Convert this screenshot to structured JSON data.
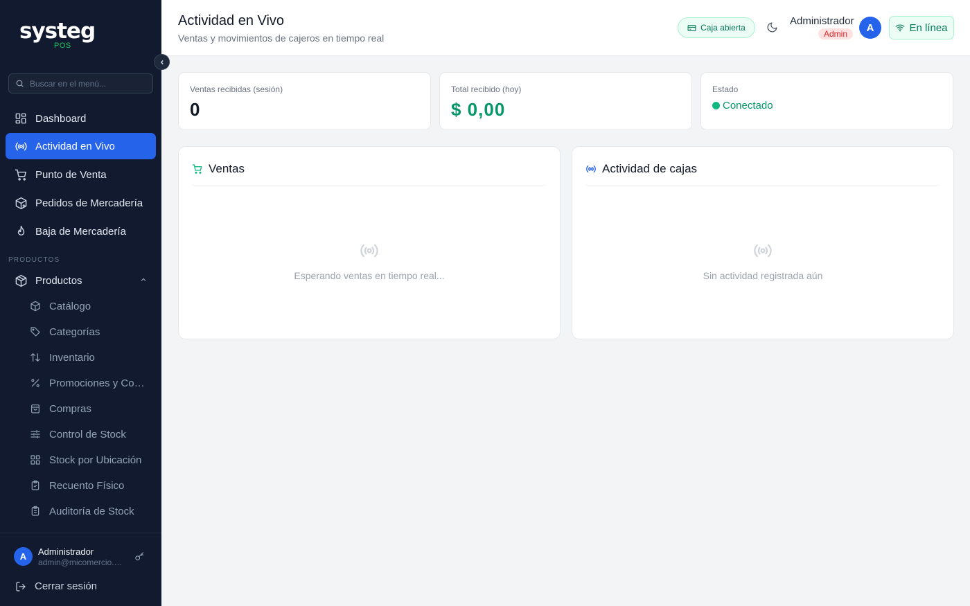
{
  "sidebar": {
    "logo_text": "systeg",
    "logo_sub": "POS",
    "search_placeholder": "Buscar en el menú...",
    "items": [
      {
        "label": "Dashboard"
      },
      {
        "label": "Actividad en Vivo",
        "active": true
      },
      {
        "label": "Punto de Venta"
      },
      {
        "label": "Pedidos de Mercadería"
      },
      {
        "label": "Baja de Mercadería"
      }
    ],
    "section_label": "PRODUCTOS",
    "group_label": "Productos",
    "sub_items": [
      {
        "label": "Catálogo"
      },
      {
        "label": "Categorías"
      },
      {
        "label": "Inventario"
      },
      {
        "label": "Promociones y Combos"
      },
      {
        "label": "Compras"
      },
      {
        "label": "Control de Stock"
      },
      {
        "label": "Stock por Ubicación"
      },
      {
        "label": "Recuento Físico"
      },
      {
        "label": "Auditoría de Stock"
      }
    ],
    "user": {
      "initial": "A",
      "name": "Administrador",
      "email": "admin@micomercio.com"
    },
    "logout_label": "Cerrar sesión"
  },
  "header": {
    "title": "Actividad en Vivo",
    "subtitle": "Ventas y movimientos de cajeros en tiempo real",
    "caja_badge": "Caja abierta",
    "admin_name": "Administrador",
    "admin_role": "Admin",
    "admin_initial": "A",
    "status_button": "En línea"
  },
  "stats": [
    {
      "label": "Ventas recibidas (sesión)",
      "value": "0"
    },
    {
      "label": "Total recibido (hoy)",
      "value": "$ 0,00"
    },
    {
      "label": "Estado",
      "value": "Conectado"
    }
  ],
  "panels": {
    "ventas": {
      "title": "Ventas",
      "empty": "Esperando ventas en tiempo real..."
    },
    "cajas": {
      "title": "Actividad de cajas",
      "empty": "Sin actividad registrada aún"
    }
  },
  "colors": {
    "sidebar_bg": "#111a2e",
    "accent": "#2563eb",
    "success": "#059669",
    "danger": "#dc2626"
  }
}
